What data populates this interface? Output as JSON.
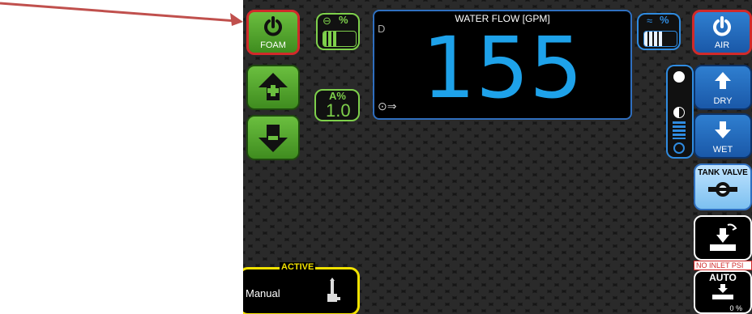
{
  "foam_button": {
    "label": "FOAM"
  },
  "foam_percent": {
    "label": "%"
  },
  "air_percent": {
    "label": "%"
  },
  "concentration": {
    "label": "A%",
    "value": "1.0"
  },
  "flow": {
    "title": "WATER FLOW [GPM]",
    "value": "155",
    "corner_letter": "D"
  },
  "air_button": {
    "label": "AIR"
  },
  "dry_button": {
    "label": "DRY"
  },
  "wet_button": {
    "label": "WET"
  },
  "tank_valve": {
    "label": "TANK VALVE"
  },
  "no_inlet": {
    "label": "NO INLET PSI"
  },
  "auto": {
    "label": "AUTO",
    "percent": "0 %"
  },
  "active_panel": {
    "title": "ACTIVE",
    "mode": "Manual"
  },
  "colors": {
    "accent_green": "#6bbf3f",
    "accent_blue": "#1ea2ea",
    "alert_red": "#d12a2a",
    "active_yellow": "#f2e200"
  },
  "icons": [
    "power-icon",
    "plus-arrow-icon",
    "minus-arrow-icon",
    "dry-arrow-icon",
    "wet-arrow-icon",
    "valve-icon",
    "nozzle-icon",
    "hand-icon"
  ]
}
